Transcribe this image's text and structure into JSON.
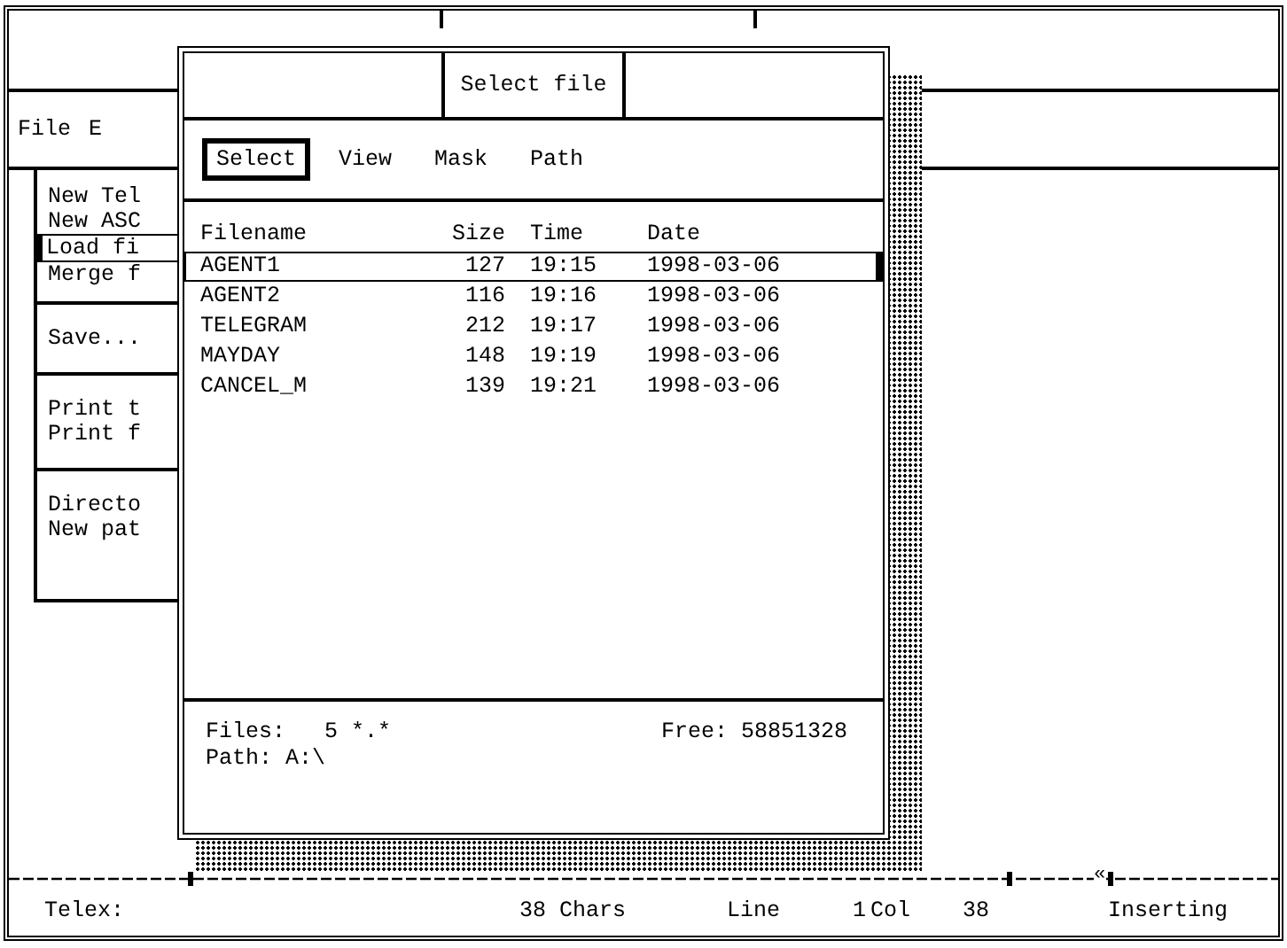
{
  "menu_bar": [
    "File",
    "E"
  ],
  "menu": {
    "groups": [
      [
        {
          "label": "New Tel",
          "selected": false
        },
        {
          "label": "New ASC",
          "selected": false
        },
        {
          "label": "Load fi",
          "selected": true
        },
        {
          "label": "Merge f",
          "selected": false
        }
      ],
      [
        {
          "label": "Save...",
          "selected": false
        }
      ],
      [
        {
          "label": "Print t",
          "selected": false
        },
        {
          "label": "Print f",
          "selected": false
        }
      ],
      [
        {
          "label": "Directo",
          "selected": false
        },
        {
          "label": "New pat",
          "selected": false
        }
      ]
    ]
  },
  "dialog": {
    "title": "Select file",
    "menu": [
      {
        "label": "Select",
        "selected": true
      },
      {
        "label": "View",
        "selected": false
      },
      {
        "label": "Mask",
        "selected": false
      },
      {
        "label": "Path",
        "selected": false
      }
    ],
    "columns": [
      "Filename",
      "Size",
      "Time",
      "Date"
    ],
    "rows": [
      {
        "cells": [
          "AGENT1",
          "127",
          "19:15",
          "1998-03-06"
        ],
        "selected": true
      },
      {
        "cells": [
          "AGENT2",
          "116",
          "19:16",
          "1998-03-06"
        ],
        "selected": false
      },
      {
        "cells": [
          "TELEGRAM",
          "212",
          "19:17",
          "1998-03-06"
        ],
        "selected": false
      },
      {
        "cells": [
          "MAYDAY",
          "148",
          "19:19",
          "1998-03-06"
        ],
        "selected": false
      },
      {
        "cells": [
          "CANCEL_M",
          "139",
          "19:21",
          "1998-03-06"
        ],
        "selected": false
      }
    ],
    "files_label": "Files:",
    "files_count": "5 *.*",
    "free": "Free: 58851328",
    "path": "Path: A:\\"
  },
  "status_bar": {
    "ruler_mark": "«",
    "label": "Telex:",
    "chars": "38 Chars",
    "line_label": "Line",
    "line": "1",
    "col_label": "Col",
    "col": "38",
    "mode": "Inserting"
  }
}
